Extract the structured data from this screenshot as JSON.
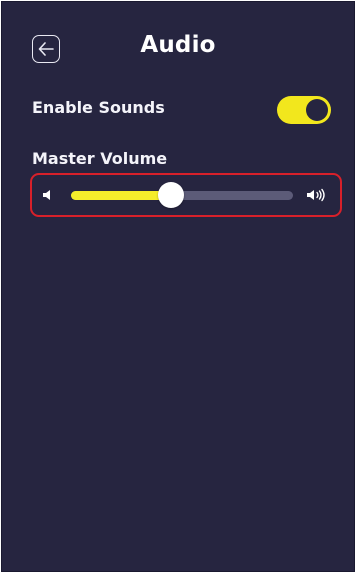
{
  "header": {
    "title": "Audio",
    "back_icon": "arrow-left-icon"
  },
  "settings": {
    "enable_sounds": {
      "label": "Enable Sounds",
      "enabled": true
    },
    "master_volume": {
      "label": "Master Volume",
      "value_percent": 45,
      "low_icon": "volume-low-icon",
      "high_icon": "volume-high-icon"
    }
  },
  "colors": {
    "background": "#262540",
    "accent": "#f2e71d",
    "track": "#5c5b78",
    "highlight_outline": "#d8202a"
  }
}
